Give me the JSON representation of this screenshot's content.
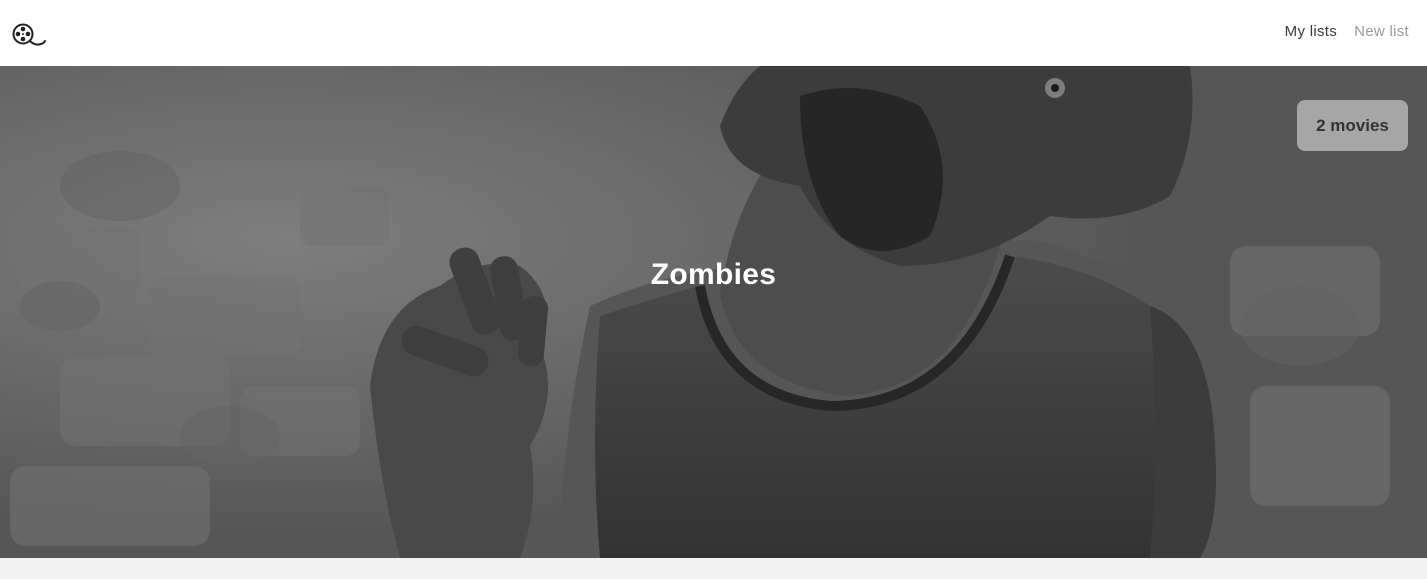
{
  "nav": {
    "logo_icon": "film-reel-magnifier-icon",
    "links": [
      {
        "label": "My lists",
        "state": "active"
      },
      {
        "label": "New list",
        "state": "inactive"
      }
    ]
  },
  "hero": {
    "title": "Zombies",
    "badge": "2 movies",
    "image": "grayscale-zombie-photo"
  },
  "colors": {
    "background": "#f2f2f2",
    "navbar": "#ffffff",
    "title_text": "#ffffff",
    "active_link": "#3a3a3a",
    "inactive_link": "#9a9a9a"
  }
}
